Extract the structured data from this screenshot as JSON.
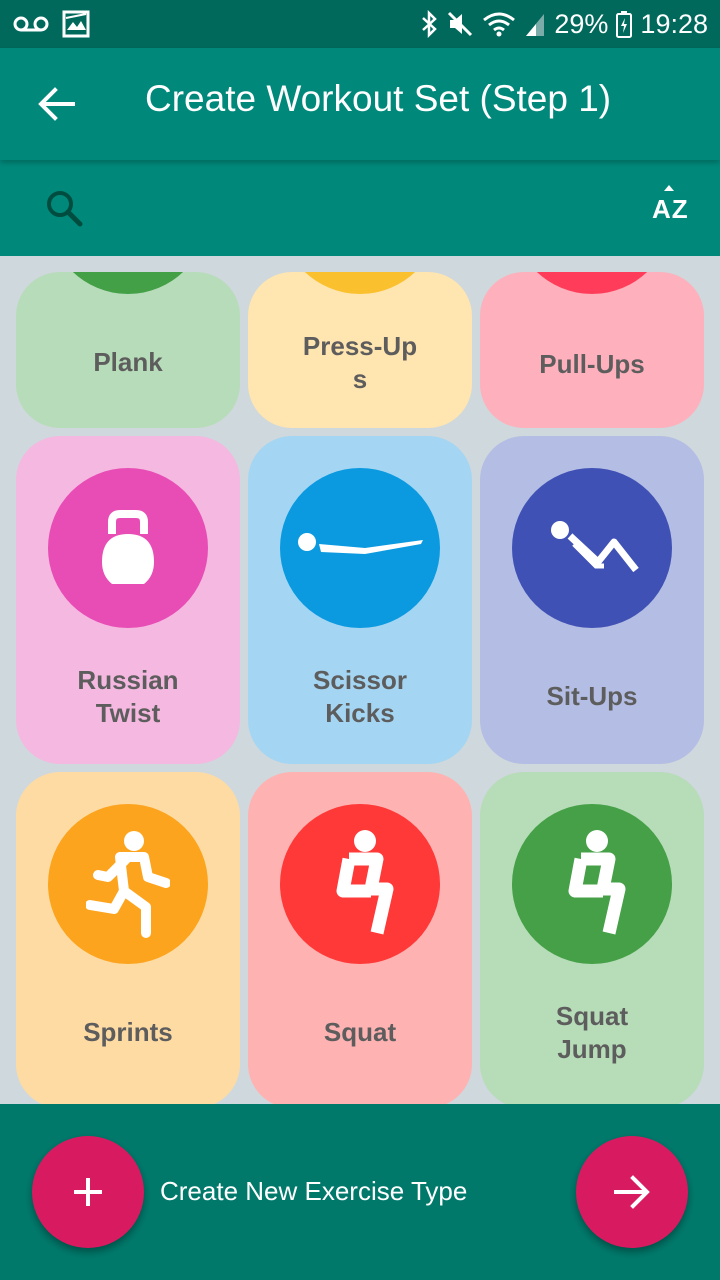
{
  "status_bar": {
    "battery": "29%",
    "time": "19:28",
    "icons": [
      "voicemail-icon",
      "gallery-notification-icon",
      "bluetooth-icon",
      "mute-icon",
      "wifi-icon",
      "signal-icon",
      "battery-charging-icon"
    ]
  },
  "app_bar": {
    "title": "Create Workout Set (Step 1)",
    "back_icon": "arrow-back-icon"
  },
  "search_bar": {
    "search_icon": "search-icon",
    "sort_label": "AZ"
  },
  "exercises": [
    {
      "label": "Plank",
      "card_color": "#b7dcb9",
      "circle_color": "#43a047",
      "icon": "none-visible"
    },
    {
      "label": "Press-Up\ns",
      "card_color": "#ffe5b0",
      "circle_color": "#fbc02d",
      "icon": "none-visible"
    },
    {
      "label": "Pull-Ups",
      "card_color": "#feb0bc",
      "circle_color": "#ff3d5a",
      "icon": "none-visible"
    },
    {
      "label": "Russian\nTwist",
      "card_color": "#f5b8e1",
      "circle_color": "#e74db5",
      "icon": "kettlebell-icon"
    },
    {
      "label": "Scissor\nKicks",
      "card_color": "#a4d6f3",
      "circle_color": "#0b99e0",
      "icon": "scissor-kicks-icon"
    },
    {
      "label": "Sit-Ups",
      "card_color": "#b4bde3",
      "circle_color": "#3f51b5",
      "icon": "sit-ups-icon"
    },
    {
      "label": "Sprints",
      "card_color": "#ffdba4",
      "circle_color": "#fca41d",
      "icon": "running-icon"
    },
    {
      "label": "Squat",
      "card_color": "#ffb2b2",
      "circle_color": "#ff3838",
      "icon": "squat-icon"
    },
    {
      "label": "Squat\nJump",
      "card_color": "#b6dcb8",
      "circle_color": "#45a047",
      "icon": "squat-jump-icon"
    }
  ],
  "bottom_bar": {
    "create_label": "Create New Exercise Type",
    "add_icon": "plus-icon",
    "next_icon": "arrow-forward-icon",
    "accent": "#d81b60"
  }
}
